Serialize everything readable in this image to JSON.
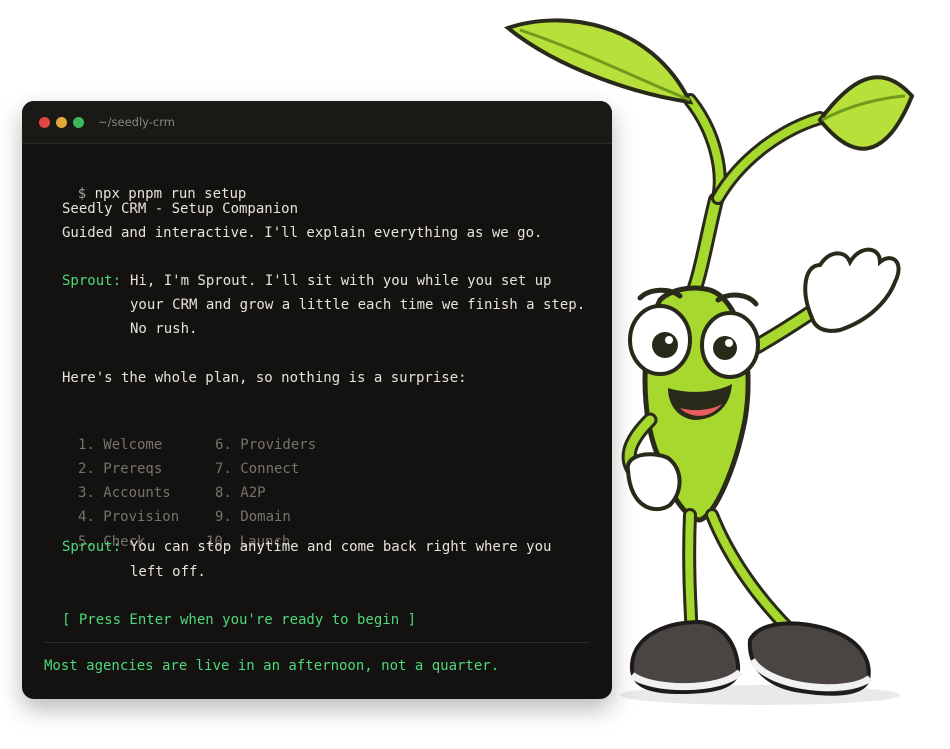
{
  "window": {
    "title": "~/seedly-crm"
  },
  "command": {
    "prompt": "$",
    "text": "npx pnpm run setup"
  },
  "intro": {
    "title": "Seedly CRM - Setup Companion",
    "subtitle": "Guided and interactive. I'll explain everything as we go."
  },
  "sprout1": {
    "speaker": "Sprout:",
    "lines": [
      "Hi, I'm Sprout. I'll sit with you while you set up",
      "your CRM and grow a little each time we finish a step.",
      "No rush."
    ]
  },
  "plan": {
    "heading": "Here's the whole plan, so nothing is a surprise:",
    "left": [
      "1. Welcome",
      "2. Prereqs",
      "3. Accounts",
      "4. Provision",
      "5. Check"
    ],
    "right": [
      "6. Providers",
      "7. Connect",
      "8. A2P",
      "9. Domain",
      "10. Launch"
    ]
  },
  "sprout2": {
    "speaker": "Sprout:",
    "lines": [
      "You can stop anytime and come back right where you",
      "left off."
    ]
  },
  "cta": "[ Press Enter when you're ready to begin ]",
  "footer": "Most agencies are live in an afternoon, not a quarter.",
  "colors": {
    "accent": "#4fd87a",
    "terminal_bg": "#131210",
    "mascot_green": "#a6d82e"
  }
}
